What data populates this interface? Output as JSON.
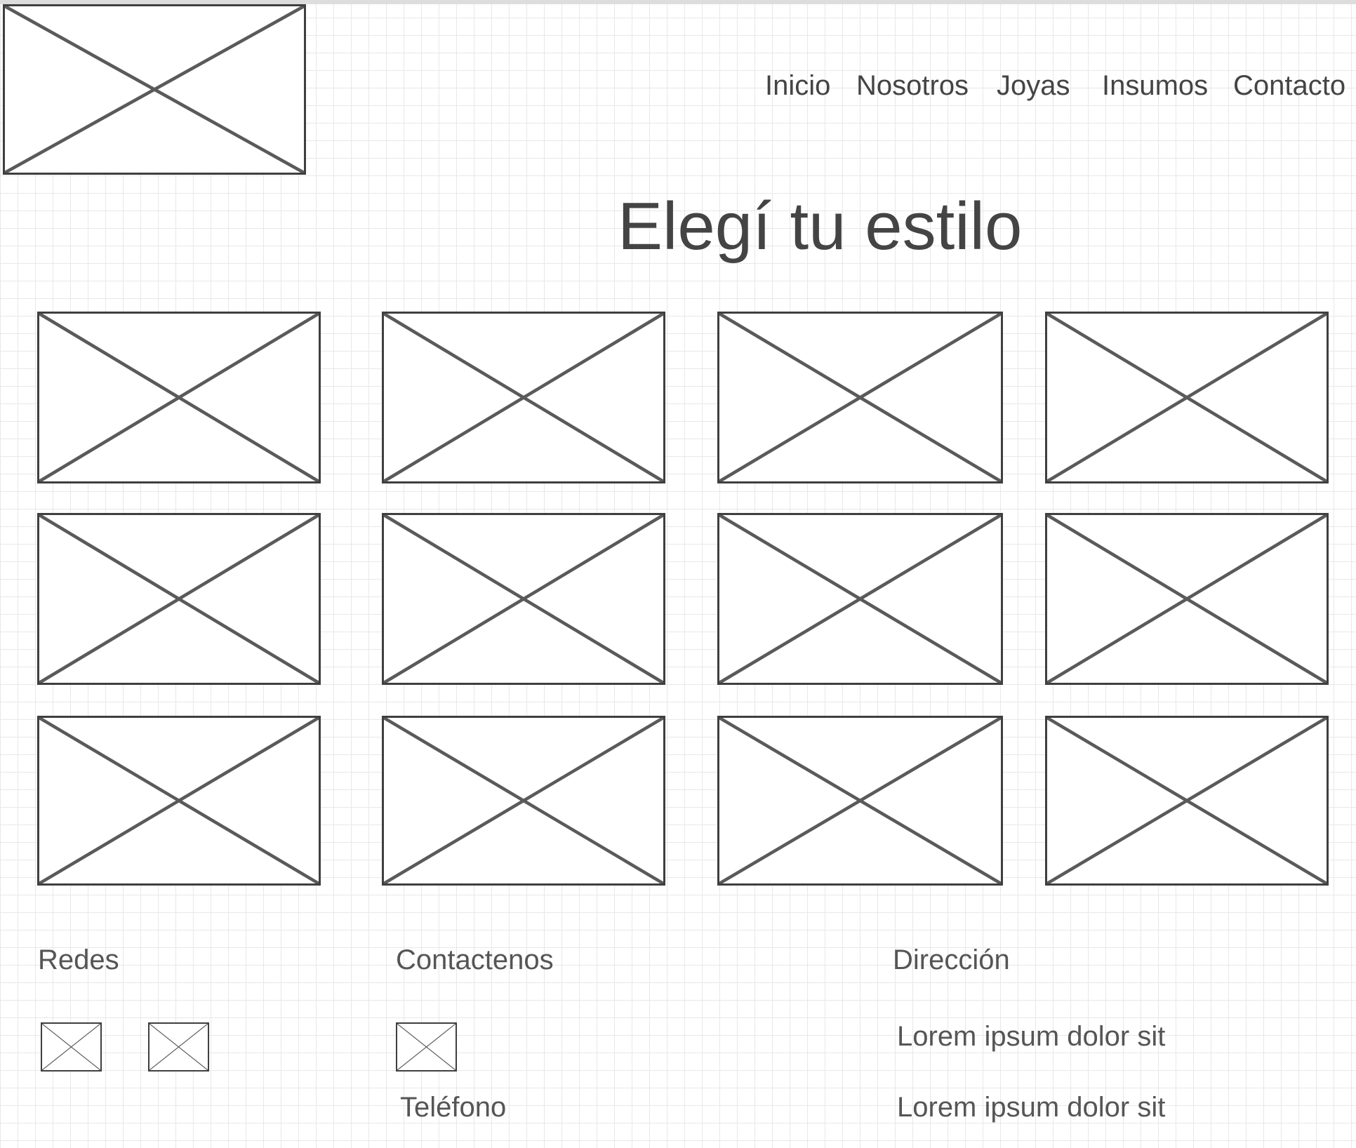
{
  "nav": {
    "items": [
      {
        "label": "Inicio"
      },
      {
        "label": "Nosotros"
      },
      {
        "label": "Joyas"
      },
      {
        "label": "Insumos"
      },
      {
        "label": "Contacto"
      }
    ]
  },
  "hero": {
    "title": "Elegí tu estilo"
  },
  "gallery": {
    "image_count": 12
  },
  "footer": {
    "social_heading": "Redes",
    "contact_heading": "Contactenos",
    "phone_label": "Teléfono",
    "address_heading": "Dirección",
    "address_lines": [
      "Lorem ipsum dolor sit",
      "Lorem ipsum dolor sit"
    ]
  }
}
